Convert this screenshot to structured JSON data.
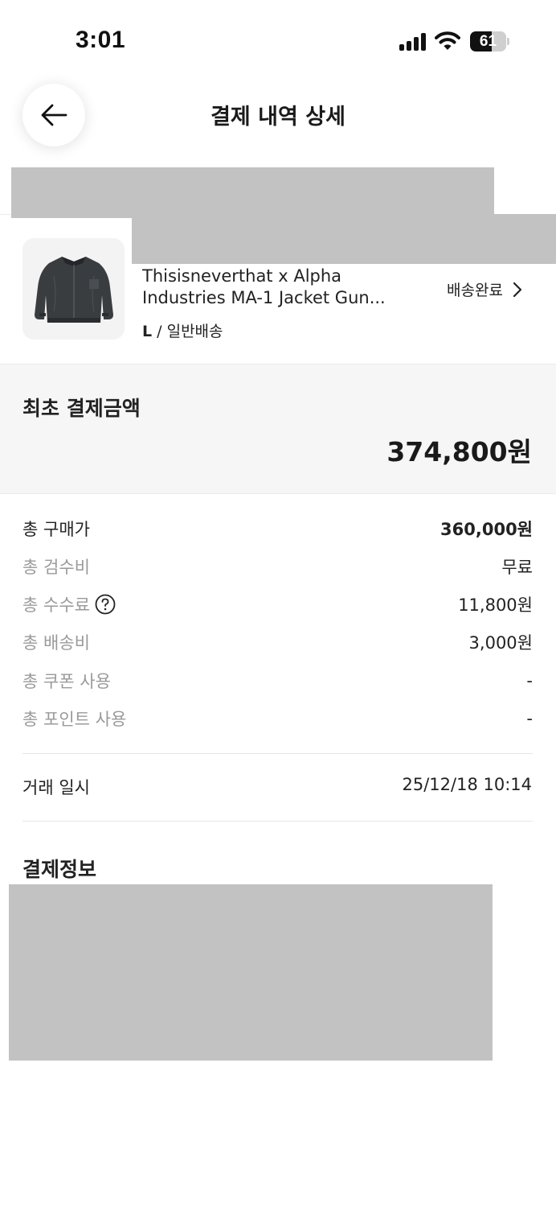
{
  "status_bar": {
    "time": "3:01",
    "battery": "61",
    "battery_level": 0.61
  },
  "header": {
    "title": "결제 내역 상세"
  },
  "product": {
    "name_line1": "Thisisneverthat x Alpha",
    "name_line2": "Industries MA-1 Jacket Gun...",
    "size": "L",
    "size_separator": " / ",
    "shipping_type": "일반배송",
    "shipping_status": "배송완료"
  },
  "total": {
    "label": "최초 결제금액",
    "amount": "374,800원"
  },
  "fees": [
    {
      "label": "총 구매가",
      "value": "360,000원"
    },
    {
      "label": "총 검수비",
      "value": "무료"
    },
    {
      "label": "총 수수료",
      "value": "11,800원"
    },
    {
      "label": "총 배송비",
      "value": "3,000원"
    },
    {
      "label": "총 쿠폰 사용",
      "value": "-"
    },
    {
      "label": "총 포인트 사용",
      "value": "-"
    }
  ],
  "trade": {
    "label": "거래 일시",
    "value": "25/12/18 10:14"
  },
  "payment": {
    "title": "결제정보"
  },
  "colors": {
    "background": "#ffffff",
    "panel": "#f6f6f6",
    "redaction": "#c2c2c2",
    "muted_text": "#9a9a9a",
    "text": "#222222"
  },
  "icons": [
    "back-arrow-icon",
    "chevron-right-icon",
    "question-circle-icon",
    "signal-icon",
    "wifi-icon",
    "battery-icon",
    "jacket-image"
  ]
}
